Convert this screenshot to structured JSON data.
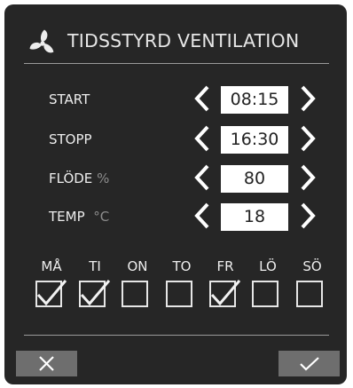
{
  "header": {
    "title": "TIDSSTYRD VENTILATION",
    "icon": "fan-icon"
  },
  "settings": [
    {
      "label": "START",
      "unit": "",
      "value": "08:15"
    },
    {
      "label": "STOPP",
      "unit": "",
      "value": "16:30"
    },
    {
      "label": "FLÖDE",
      "unit": "%",
      "value": "80"
    },
    {
      "label": "TEMP",
      "unit": "°C",
      "value": "18"
    }
  ],
  "days": [
    {
      "label": "MÅ",
      "checked": true
    },
    {
      "label": "TI",
      "checked": true
    },
    {
      "label": "ON",
      "checked": false
    },
    {
      "label": "TO",
      "checked": false
    },
    {
      "label": "FR",
      "checked": true
    },
    {
      "label": "LÖ",
      "checked": false
    },
    {
      "label": "SÖ",
      "checked": false
    }
  ],
  "footer": {
    "cancel_icon": "close-icon",
    "confirm_icon": "check-icon"
  },
  "colors": {
    "panel": "#262626",
    "text": "#ededed",
    "unit": "#8c8c8c",
    "button": "#6e6e6e",
    "value_box": "#ffffff"
  }
}
